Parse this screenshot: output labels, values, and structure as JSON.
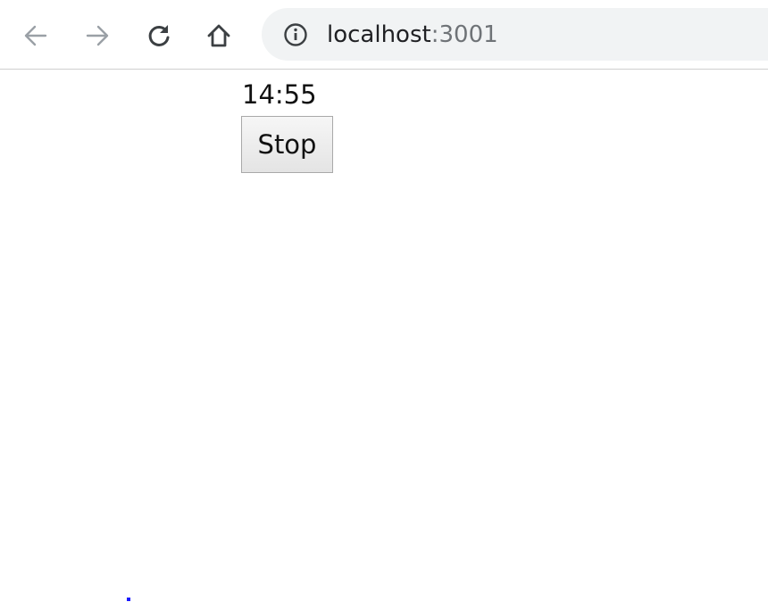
{
  "browser": {
    "url_host": "localhost",
    "url_port": ":3001",
    "icons": {
      "back": "arrow-left-icon",
      "forward": "arrow-right-icon",
      "reload": "reload-icon",
      "home": "home-icon",
      "info": "info-icon"
    }
  },
  "page": {
    "time": "14:55",
    "stop_label": "Stop"
  },
  "colors": {
    "omnibox_bg": "#f1f3f4",
    "dot": "#1a1aff"
  }
}
